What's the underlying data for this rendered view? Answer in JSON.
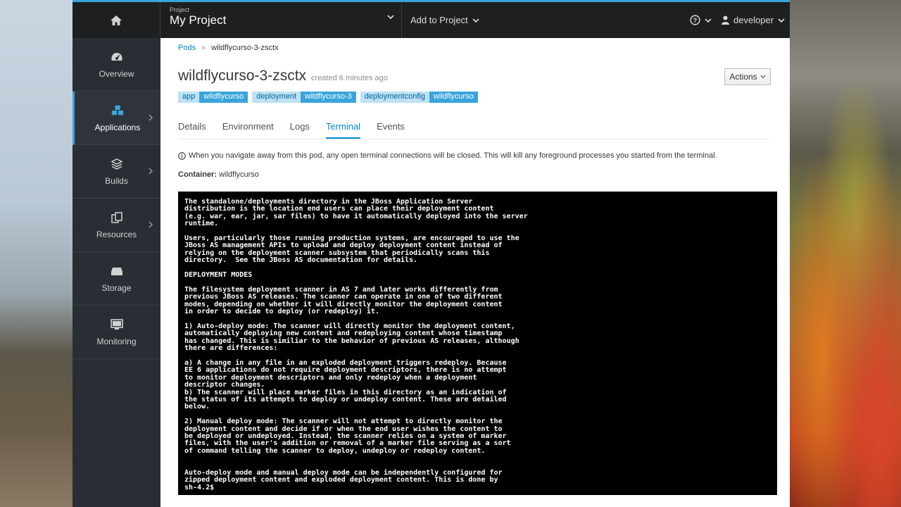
{
  "topbar": {
    "project_label": "Project",
    "project_name": "My Project",
    "add_to_project": "Add to Project",
    "user": "developer"
  },
  "sidebar": {
    "items": [
      {
        "label": "Overview",
        "icon": "dashboard-icon"
      },
      {
        "label": "Applications",
        "icon": "cubes-icon",
        "active": true
      },
      {
        "label": "Builds",
        "icon": "layers-icon"
      },
      {
        "label": "Resources",
        "icon": "copy-icon"
      },
      {
        "label": "Storage",
        "icon": "database-icon"
      },
      {
        "label": "Monitoring",
        "icon": "monitor-icon"
      }
    ]
  },
  "breadcrumb": {
    "parent": "Pods",
    "current": "wildflycurso-3-zsctx"
  },
  "pod": {
    "title": "wildflycurso-3-zsctx",
    "created": "created 6 minutes ago",
    "actions": "Actions"
  },
  "labels": [
    {
      "key": "app",
      "value": "wildflycurso"
    },
    {
      "key": "deployment",
      "value": "wildflycurso-3"
    },
    {
      "key": "deploymentconfig",
      "value": "wildflycurso"
    }
  ],
  "tabs": [
    "Details",
    "Environment",
    "Logs",
    "Terminal",
    "Events"
  ],
  "active_tab": "Terminal",
  "notice": "When you navigate away from this pod, any open terminal connections will be closed. This will kill any foreground processes you started from the terminal.",
  "container": {
    "label": "Container:",
    "value": "wildflycurso"
  },
  "terminal_lines": [
    "The standalone/deployments directory in the JBoss Application Server",
    "distribution is the location end users can place their deployment content",
    "(e.g. war, ear, jar, sar files) to have it automatically deployed into the server",
    "runtime.",
    "",
    "Users, particularly those running production systems, are encouraged to use the",
    "JBoss AS management APIs to upload and deploy deployment content instead of",
    "relying on the deployment scanner subsystem that periodically scans this",
    "directory.  See the JBoss AS documentation for details.",
    "",
    "DEPLOYMENT MODES",
    "",
    "The filesystem deployment scanner in AS 7 and later works differently from",
    "previous JBoss AS releases. The scanner can operate in one of two different",
    "modes, depending on whether it will directly monitor the deployment content",
    "in order to decide to deploy (or redeploy) it.",
    "",
    "1) Auto-deploy mode: The scanner will directly monitor the deployment content,",
    "automatically deploying new content and redeploying content whose timestamp",
    "has changed. This is similiar to the behavior of previous AS releases, although",
    "there are differences:",
    "",
    "a) A change in any file in an exploded deployment triggers redeploy. Because",
    "EE 6 applications do not require deployment descriptors, there is no attempt",
    "to monitor deployment descriptors and only redeploy when a deployment",
    "descriptor changes.",
    "b) The scanner will place marker files in this directory as an indication of",
    "the status of its attempts to deploy or undeploy content. These are detailed",
    "below.",
    "",
    "2) Manual deploy mode: The scanner will not attempt to directly monitor the",
    "deployment content and decide if or when the end user wishes the content to",
    "be deployed or undeployed. Instead, the scanner relies on a system of marker",
    "files, with the user's addition or removal of a marker file serving as a sort",
    "of command telling the scanner to deploy, undeploy or redeploy content.",
    "",
    "",
    "Auto-deploy mode and manual deploy mode can be independently configured for",
    "zipped deployment content and exploded deployment content. This is done by",
    "sh-4.2$"
  ]
}
